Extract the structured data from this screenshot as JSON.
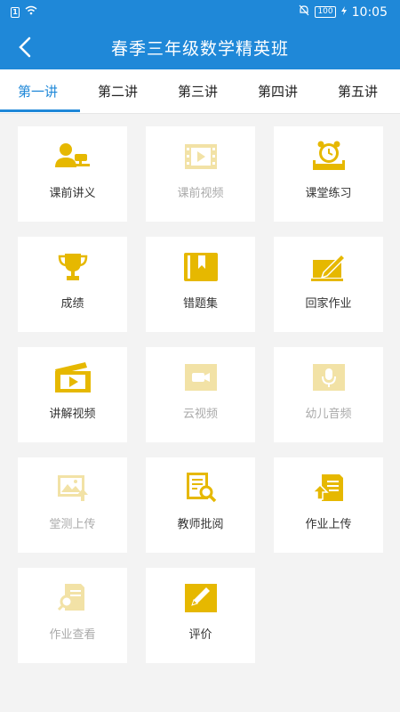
{
  "status_bar": {
    "time": "10:05",
    "battery": "100"
  },
  "header": {
    "title": "春季三年级数学精英班"
  },
  "tabs": [
    {
      "label": "第一讲",
      "active": true
    },
    {
      "label": "第二讲"
    },
    {
      "label": "第三讲"
    },
    {
      "label": "第四讲"
    },
    {
      "label": "第五讲"
    }
  ],
  "colors": {
    "primary": "#1f88d8",
    "icon_active": "#e6b800",
    "icon_disabled": "#f2e2a6"
  },
  "cards": [
    {
      "label": "课前讲义",
      "icon": "lecturer-icon",
      "enabled": true
    },
    {
      "label": "课前视频",
      "icon": "film-icon",
      "enabled": false
    },
    {
      "label": "课堂练习",
      "icon": "alarm-clock-desk-icon",
      "enabled": true
    },
    {
      "label": "成绩",
      "icon": "trophy-icon",
      "enabled": true
    },
    {
      "label": "错题集",
      "icon": "bookmark-book-icon",
      "enabled": true
    },
    {
      "label": "回家作业",
      "icon": "pencil-paper-icon",
      "enabled": true
    },
    {
      "label": "讲解视频",
      "icon": "clapper-icon",
      "enabled": true
    },
    {
      "label": "云视频",
      "icon": "video-camera-icon",
      "enabled": false
    },
    {
      "label": "幼儿音频",
      "icon": "microphone-icon",
      "enabled": false
    },
    {
      "label": "堂测上传",
      "icon": "image-upload-icon",
      "enabled": false
    },
    {
      "label": "教师批阅",
      "icon": "document-search-icon",
      "enabled": true
    },
    {
      "label": "作业上传",
      "icon": "homework-upload-icon",
      "enabled": true
    },
    {
      "label": "作业查看",
      "icon": "homework-view-icon",
      "enabled": false
    },
    {
      "label": "评价",
      "icon": "edit-icon",
      "enabled": true
    }
  ]
}
